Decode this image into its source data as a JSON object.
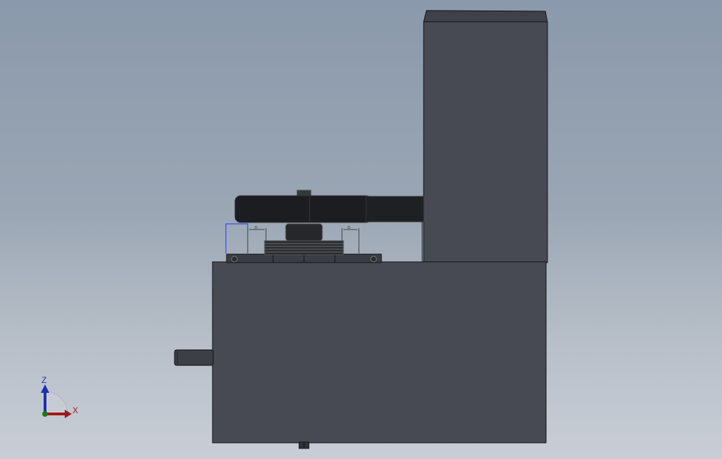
{
  "viewport": {
    "background_top": "#8a99ab",
    "background_bottom": "#c9ced6",
    "model_body_color": "#474a52",
    "model_edge_color": "#111111",
    "belt_color": "#1c1d20",
    "dimension_color": "#1a3cff"
  },
  "triad": {
    "z_label": "Z",
    "x_label": "X",
    "z_color": "#1b2fb0",
    "x_color": "#a01818",
    "y_color": "#1a7a1a"
  },
  "dimensions": {
    "left_text": "D",
    "right_text": "D"
  }
}
